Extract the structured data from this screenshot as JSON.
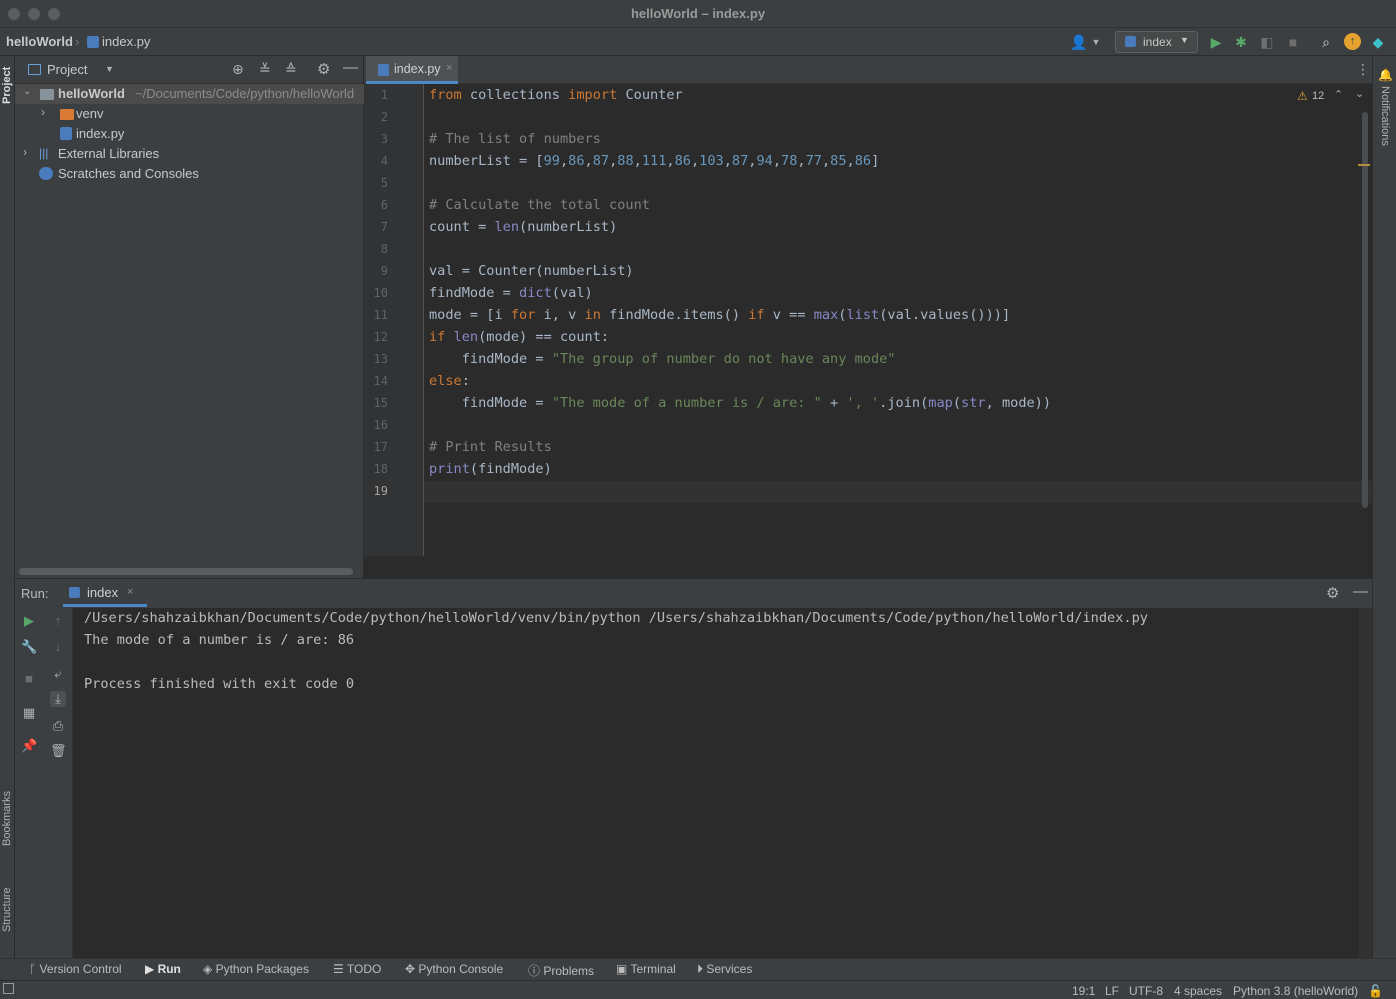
{
  "window": {
    "title": "helloWorld – index.py"
  },
  "nav": {
    "project": "helloWorld",
    "file": "index.py"
  },
  "toolbar": {
    "run_config": "index"
  },
  "left_strip": {
    "project": "Project",
    "bookmarks": "Bookmarks",
    "structure": "Structure"
  },
  "right_strip": {
    "notifications": "Notifications"
  },
  "project_panel": {
    "title": "Project",
    "tree": [
      {
        "label": "helloWorld",
        "hint": "~/Documents/Code/python/helloWorld"
      },
      {
        "label": "venv"
      },
      {
        "label": "index.py"
      },
      {
        "label": "External Libraries"
      },
      {
        "label": "Scratches and Consoles"
      }
    ]
  },
  "editor": {
    "tab": "index.py",
    "warnings": "12",
    "line_numbers": [
      "1",
      "2",
      "3",
      "4",
      "5",
      "6",
      "7",
      "8",
      "9",
      "10",
      "11",
      "12",
      "13",
      "14",
      "15",
      "16",
      "17",
      "18",
      "19"
    ],
    "code": [
      [
        {
          "t": "from",
          "c": "kw"
        },
        {
          "t": " collections "
        },
        {
          "t": "import",
          "c": "kw"
        },
        {
          "t": " Counter"
        }
      ],
      [],
      [
        {
          "t": "# The list of numbers",
          "c": "cm"
        }
      ],
      [
        {
          "t": "numberList = ["
        },
        {
          "t": "99",
          "c": "num"
        },
        {
          "t": ","
        },
        {
          "t": "86",
          "c": "num"
        },
        {
          "t": ","
        },
        {
          "t": "87",
          "c": "num"
        },
        {
          "t": ","
        },
        {
          "t": "88",
          "c": "num"
        },
        {
          "t": ","
        },
        {
          "t": "111",
          "c": "num"
        },
        {
          "t": ","
        },
        {
          "t": "86",
          "c": "num"
        },
        {
          "t": ","
        },
        {
          "t": "103",
          "c": "num"
        },
        {
          "t": ","
        },
        {
          "t": "87",
          "c": "num"
        },
        {
          "t": ","
        },
        {
          "t": "94",
          "c": "num"
        },
        {
          "t": ","
        },
        {
          "t": "78",
          "c": "num"
        },
        {
          "t": ","
        },
        {
          "t": "77",
          "c": "num"
        },
        {
          "t": ","
        },
        {
          "t": "85",
          "c": "num"
        },
        {
          "t": ","
        },
        {
          "t": "86",
          "c": "num"
        },
        {
          "t": "]"
        }
      ],
      [],
      [
        {
          "t": "# Calculate the total count",
          "c": "cm"
        }
      ],
      [
        {
          "t": "count = "
        },
        {
          "t": "len",
          "c": "bi"
        },
        {
          "t": "(numberList)"
        }
      ],
      [],
      [
        {
          "t": "val = Counter(numberList)"
        }
      ],
      [
        {
          "t": "findMode = "
        },
        {
          "t": "dict",
          "c": "bi"
        },
        {
          "t": "(val)"
        }
      ],
      [
        {
          "t": "mode = [i "
        },
        {
          "t": "for",
          "c": "kw"
        },
        {
          "t": " i, v "
        },
        {
          "t": "in",
          "c": "kw"
        },
        {
          "t": " findMode.items() "
        },
        {
          "t": "if",
          "c": "kw"
        },
        {
          "t": " v == "
        },
        {
          "t": "max",
          "c": "bi"
        },
        {
          "t": "("
        },
        {
          "t": "list",
          "c": "bi"
        },
        {
          "t": "(val.values()))]"
        }
      ],
      [
        {
          "t": "if",
          "c": "kw"
        },
        {
          "t": " "
        },
        {
          "t": "len",
          "c": "bi"
        },
        {
          "t": "(mode) == count:"
        }
      ],
      [
        {
          "t": "    findMode = "
        },
        {
          "t": "\"The group of number do not have any mode\"",
          "c": "str"
        }
      ],
      [
        {
          "t": "else",
          "c": "kw"
        },
        {
          "t": ":"
        }
      ],
      [
        {
          "t": "    findMode = "
        },
        {
          "t": "\"The mode of a number is / are: \"",
          "c": "str"
        },
        {
          "t": " + "
        },
        {
          "t": "', '",
          "c": "str"
        },
        {
          "t": ".join("
        },
        {
          "t": "map",
          "c": "bi"
        },
        {
          "t": "("
        },
        {
          "t": "str",
          "c": "bi"
        },
        {
          "t": ", mode))"
        }
      ],
      [],
      [
        {
          "t": "# Print Results",
          "c": "cm"
        }
      ],
      [
        {
          "t": "print",
          "c": "bi"
        },
        {
          "t": "(findMode)"
        }
      ],
      []
    ]
  },
  "run": {
    "label": "Run:",
    "tab": "index",
    "output": [
      "/Users/shahzaibkhan/Documents/Code/python/helloWorld/venv/bin/python /Users/shahzaibkhan/Documents/Code/python/helloWorld/index.py",
      "The mode of a number is / are: 86",
      "",
      "Process finished with exit code 0"
    ]
  },
  "tool_windows": [
    "Version Control",
    "Run",
    "Python Packages",
    "TODO",
    "Python Console",
    "Problems",
    "Terminal",
    "Services"
  ],
  "status": {
    "position": "19:1",
    "line_sep": "LF",
    "encoding": "UTF-8",
    "indent": "4 spaces",
    "interpreter": "Python 3.8 (helloWorld)"
  },
  "colors": {
    "background": "#2b2b2b",
    "panel": "#3c3f41",
    "keyword": "#cc7832",
    "number": "#6897bb",
    "string": "#6a8759",
    "comment": "#808080",
    "builtin": "#8888c6",
    "run_green": "#59a869"
  }
}
